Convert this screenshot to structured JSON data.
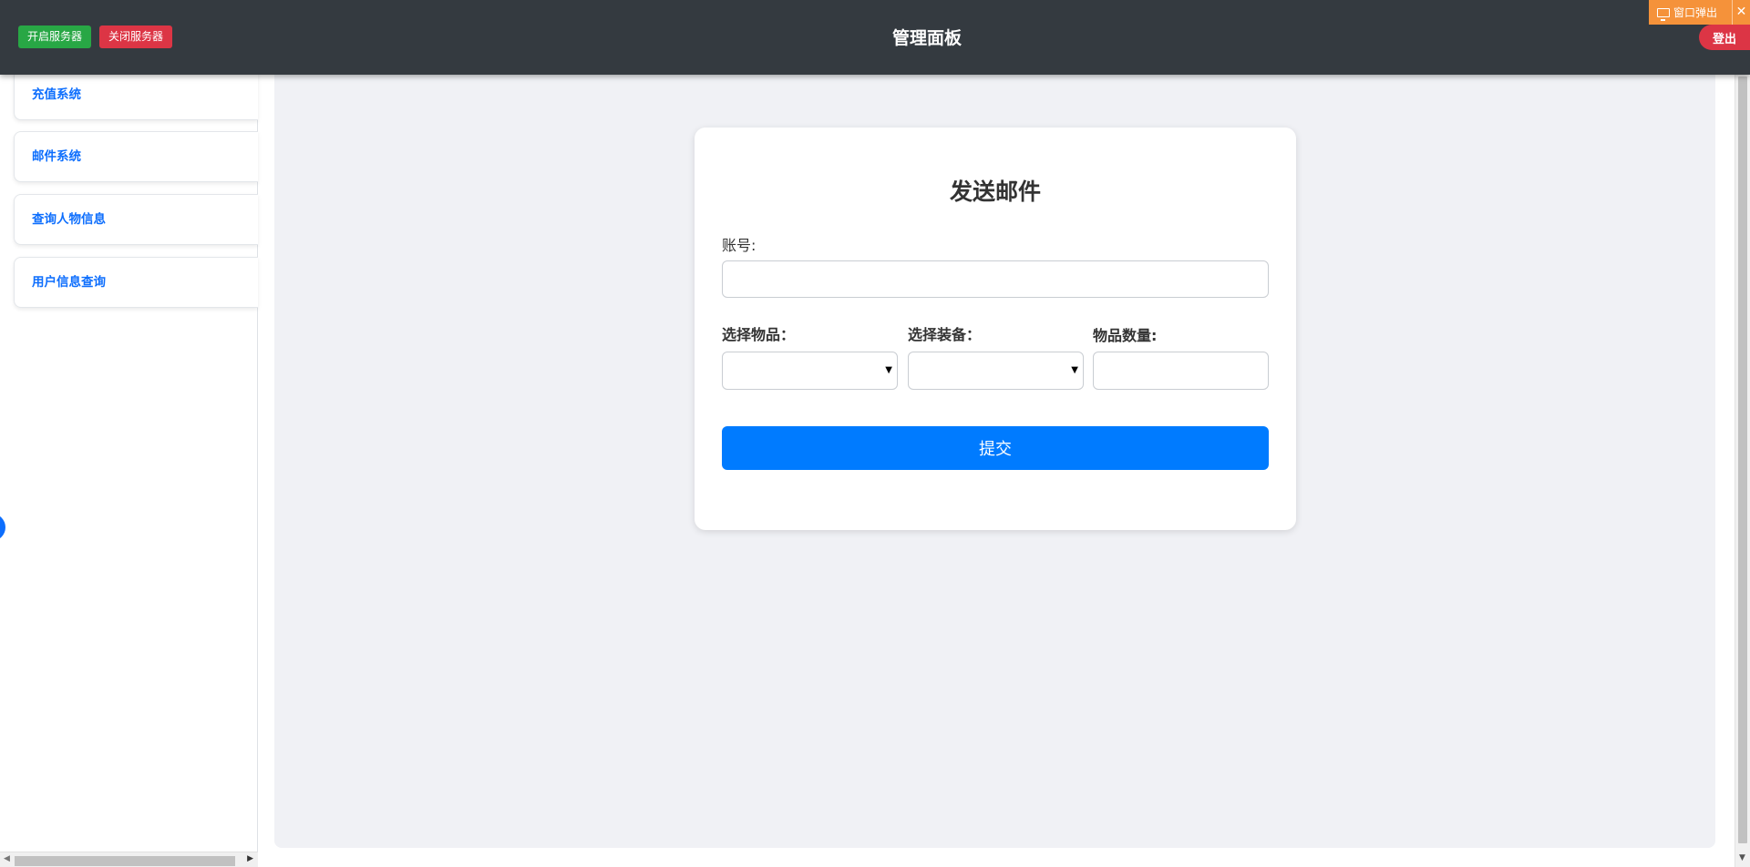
{
  "header": {
    "start_server": "开启服务器",
    "stop_server": "关闭服务器",
    "title": "管理面板",
    "logout": "登出"
  },
  "popup": {
    "label": "窗口弹出",
    "close": "✕",
    "icon": "monitor-icon"
  },
  "sidebar": {
    "items": [
      {
        "label": "充值系统"
      },
      {
        "label": "邮件系统"
      },
      {
        "label": "查询人物信息"
      },
      {
        "label": "用户信息查询"
      }
    ]
  },
  "form": {
    "title": "发送邮件",
    "account_label": "账号:",
    "account_value": "",
    "item_label": "选择物品：",
    "item_value": "",
    "equip_label": "选择装备：",
    "equip_value": "",
    "qty_label": "物品数量:",
    "qty_value": "",
    "submit": "提交"
  },
  "colors": {
    "header_bg": "#343a40",
    "start_btn": "#28a745",
    "stop_btn": "#dc3545",
    "primary": "#007bff",
    "popup_bg": "#f5923a",
    "main_bg": "#f0f1f5"
  }
}
